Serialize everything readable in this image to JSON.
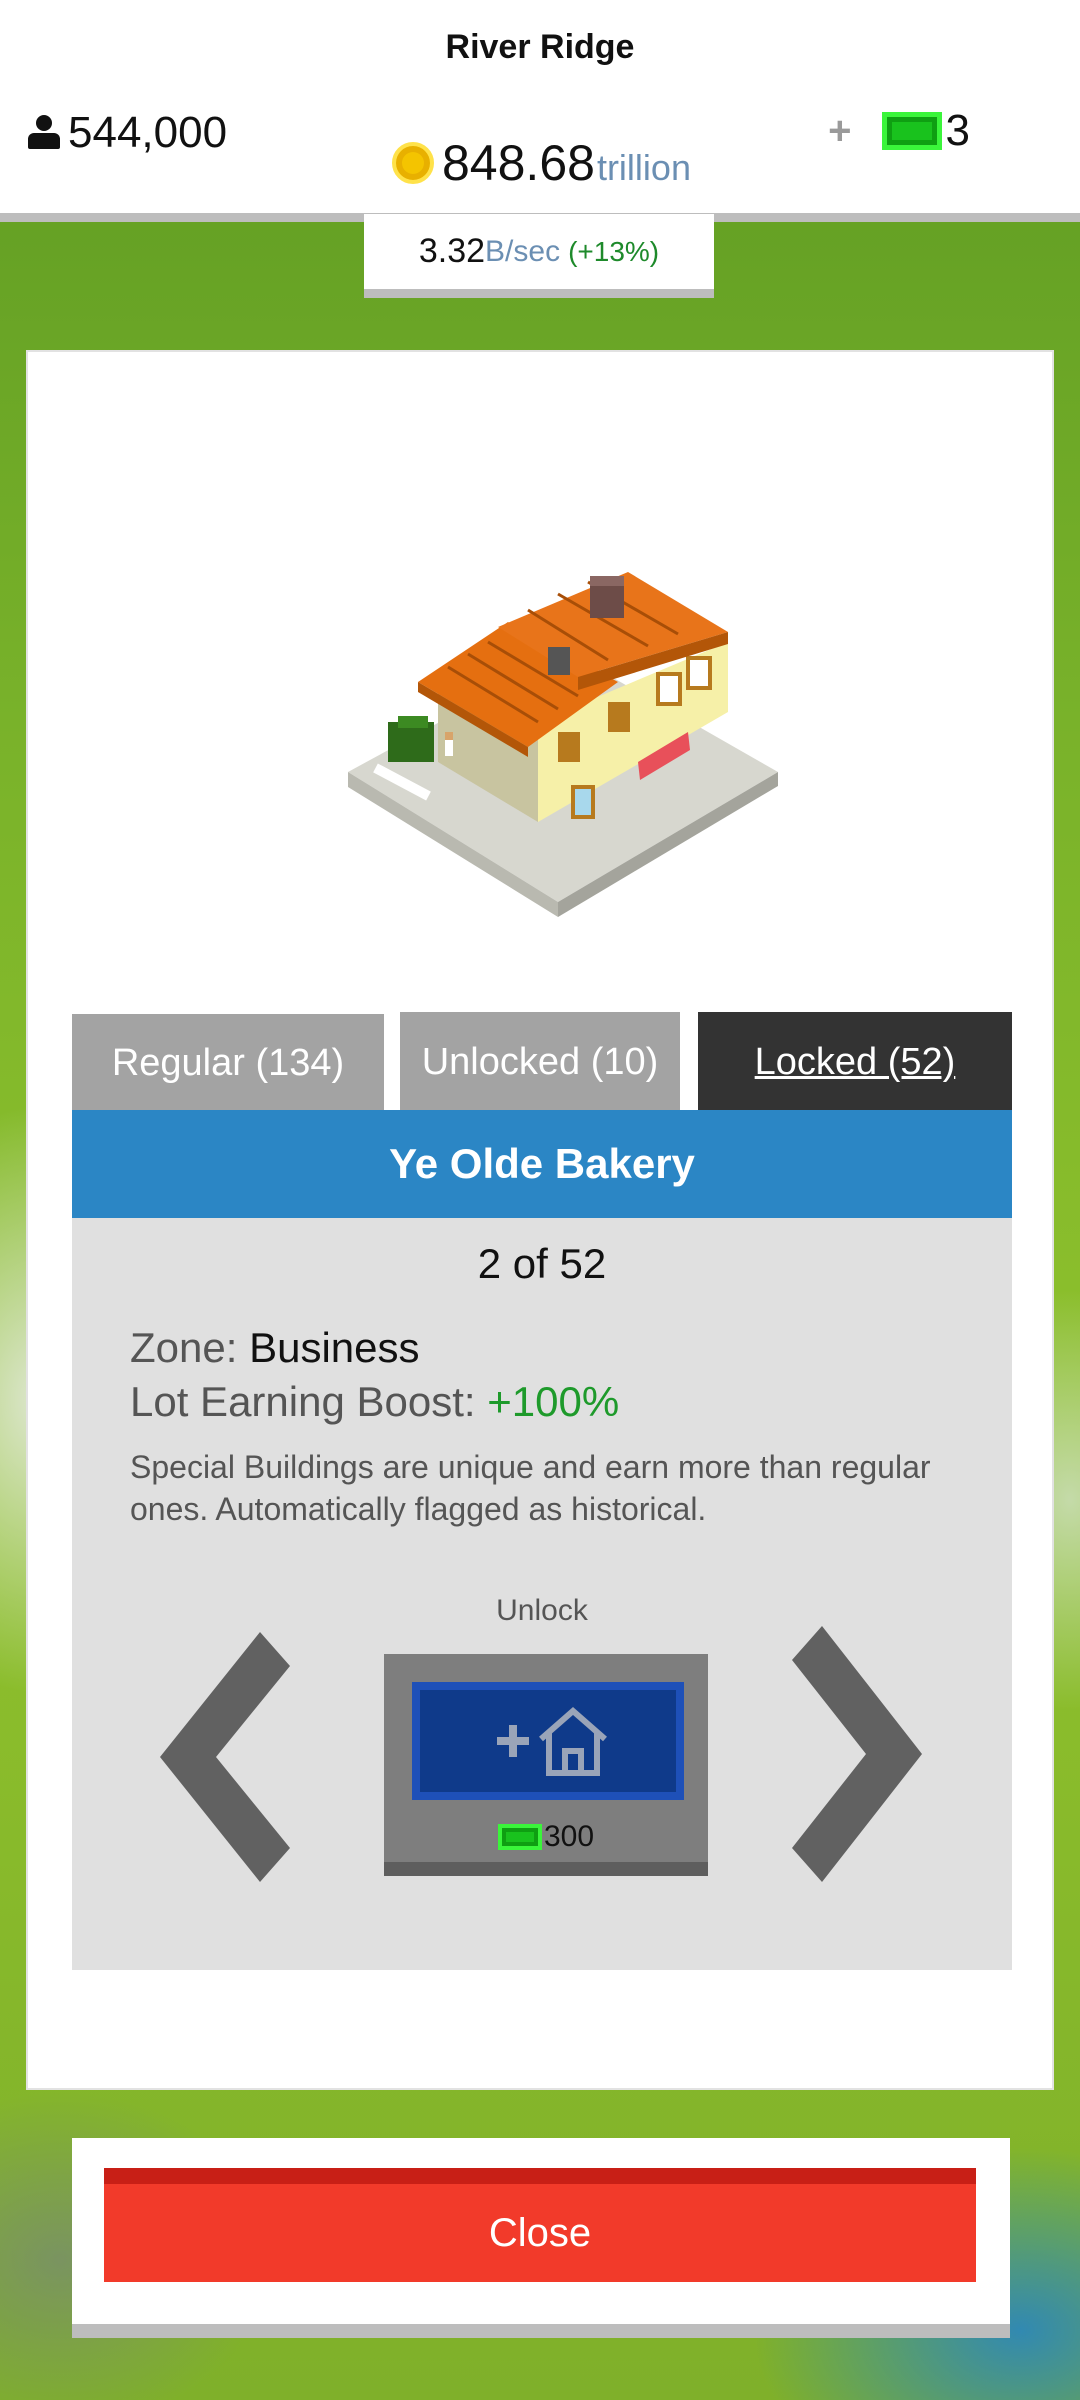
{
  "hud": {
    "city_name": "River Ridge",
    "population": "544,000",
    "money_value": "848.68",
    "money_unit": "trillion",
    "plus": "+",
    "cash_value": "3",
    "rate_value": "3.32",
    "rate_unit": "B/sec",
    "rate_pct": "(+13%)"
  },
  "tabs": {
    "regular": "Regular (134)",
    "unlocked": "Unlocked (10)",
    "locked": "Locked (52)",
    "active": "locked"
  },
  "building": {
    "name": "Ye Olde Bakery",
    "counter": "2 of 52",
    "zone_label": "Zone:",
    "zone_value": "Business",
    "boost_label": "Lot Earning Boost:",
    "boost_value": "+100%",
    "description": "Special Buildings are unique and earn more than regular ones. Automatically flagged as historical."
  },
  "unlock": {
    "label": "Unlock",
    "price": "300",
    "icon": "add-house-icon"
  },
  "close_label": "Close",
  "colors": {
    "accent_blue": "#2b86c5",
    "close_red": "#f23a2a",
    "active_tab": "#333333",
    "inactive_tab": "#a3a3a3",
    "boost_green": "#1e9a2b",
    "cash_green": "#19c21d",
    "coin_gold": "#f4c400"
  }
}
